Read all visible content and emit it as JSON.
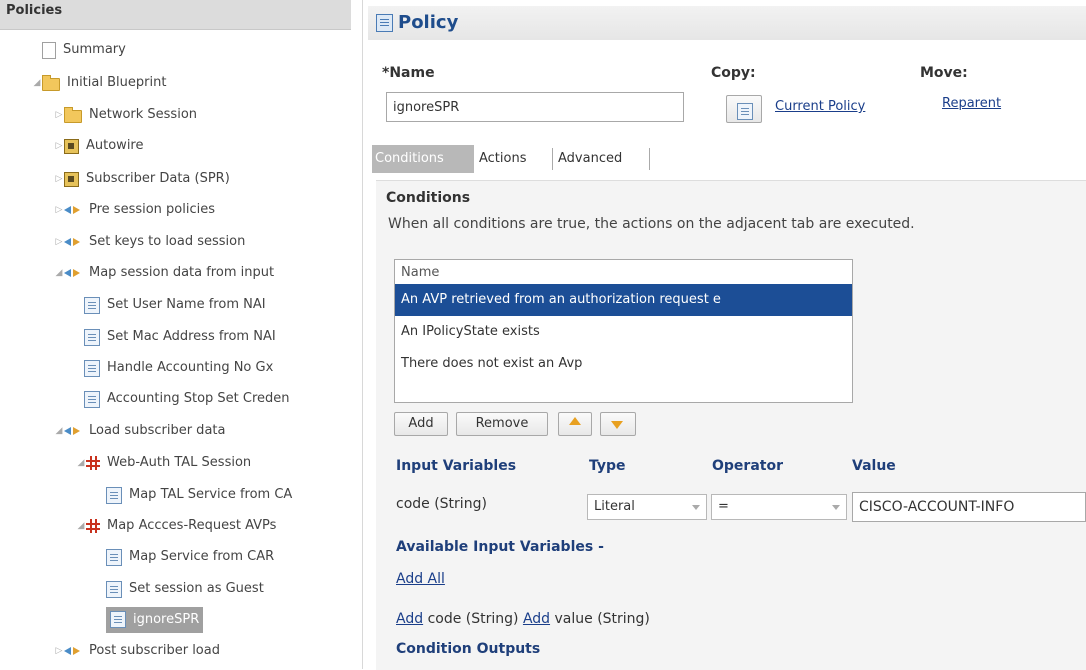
{
  "sidebar": {
    "header": "Policies",
    "items": [
      {
        "label": "Summary",
        "icon": "document-icon"
      },
      {
        "label": "Initial Blueprint",
        "icon": "folder-open-icon"
      },
      {
        "label": "Network Session",
        "icon": "folder-icon"
      },
      {
        "label": "Autowire",
        "icon": "autowire-icon"
      },
      {
        "label": "Subscriber Data (SPR)",
        "icon": "autowire-icon"
      },
      {
        "label": "Pre session policies",
        "icon": "arrows-icon"
      },
      {
        "label": "Set keys to load session",
        "icon": "arrows-icon"
      },
      {
        "label": "Map session data from input",
        "icon": "arrows-icon"
      },
      {
        "label": "Set User Name from NAI",
        "icon": "form-icon"
      },
      {
        "label": "Set Mac Address from NAI",
        "icon": "form-icon"
      },
      {
        "label": "Handle Accounting No Gx",
        "icon": "form-icon"
      },
      {
        "label": "Accounting Stop Set Creden",
        "icon": "form-icon"
      },
      {
        "label": "Load subscriber data",
        "icon": "arrows-icon"
      },
      {
        "label": "Web-Auth TAL Session",
        "icon": "grid-icon"
      },
      {
        "label": "Map TAL Service from CA",
        "icon": "form-icon"
      },
      {
        "label": "Map Accces-Request AVPs",
        "icon": "grid-icon"
      },
      {
        "label": "Map Service from CAR",
        "icon": "form-icon"
      },
      {
        "label": "Set session as Guest",
        "icon": "form-icon"
      },
      {
        "label": "ignoreSPR",
        "icon": "form-icon",
        "selected": true
      },
      {
        "label": "Post subscriber load",
        "icon": "arrows-icon"
      }
    ]
  },
  "policy": {
    "title": "Policy",
    "name_label": "*Name",
    "name_value": "ignoreSPR",
    "copy_label": "Copy:",
    "copy_link": "Current Policy",
    "move_label": "Move:",
    "move_link": "Reparent"
  },
  "tabs": [
    "Conditions",
    "Actions",
    "Advanced"
  ],
  "conditions": {
    "title": "Conditions",
    "description": "When all conditions are true, the actions on the adjacent tab are executed.",
    "list_header": "Name",
    "rows": [
      "An AVP retrieved from an authorization request e",
      "An IPolicyState exists",
      "There does not exist an Avp"
    ],
    "buttons": {
      "add": "Add",
      "remove": "Remove"
    }
  },
  "input_variables": {
    "headers": {
      "input": "Input Variables",
      "type": "Type",
      "operator": "Operator",
      "value": "Value"
    },
    "row": {
      "name": "code (String)",
      "type": "Literal",
      "operator": "=",
      "value": "CISCO-ACCOUNT-INFO"
    }
  },
  "available": {
    "title": "Available Input Variables -",
    "add_all": "Add All",
    "add1": "Add",
    "var1": "code (String)",
    "add2": "Add",
    "var2": "value (String)"
  },
  "outputs_title": "Condition Outputs"
}
